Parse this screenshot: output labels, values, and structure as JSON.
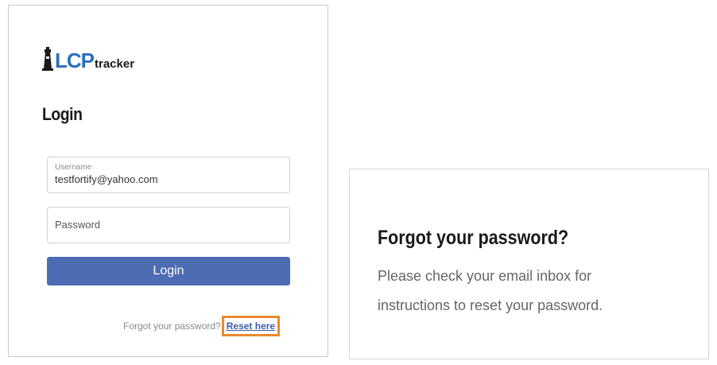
{
  "login": {
    "logo": {
      "brand": "LCP",
      "suffix": "tracker"
    },
    "heading": "Login",
    "username": {
      "label": "Username",
      "value": "testfortify@yahoo.com"
    },
    "password": {
      "placeholder": "Password"
    },
    "submit_label": "Login",
    "forgot_prompt": "Forgot your password?",
    "reset_link": "Reset here"
  },
  "forgot_panel": {
    "title": "Forgot your password?",
    "message_line1": "Please check your email inbox for",
    "message_line2": "instructions to reset your password."
  },
  "colors": {
    "button": "#4c6cb3",
    "highlight": "#e98a2c",
    "link": "#3d5ca8",
    "logo_blue": "#2b6fb7"
  }
}
